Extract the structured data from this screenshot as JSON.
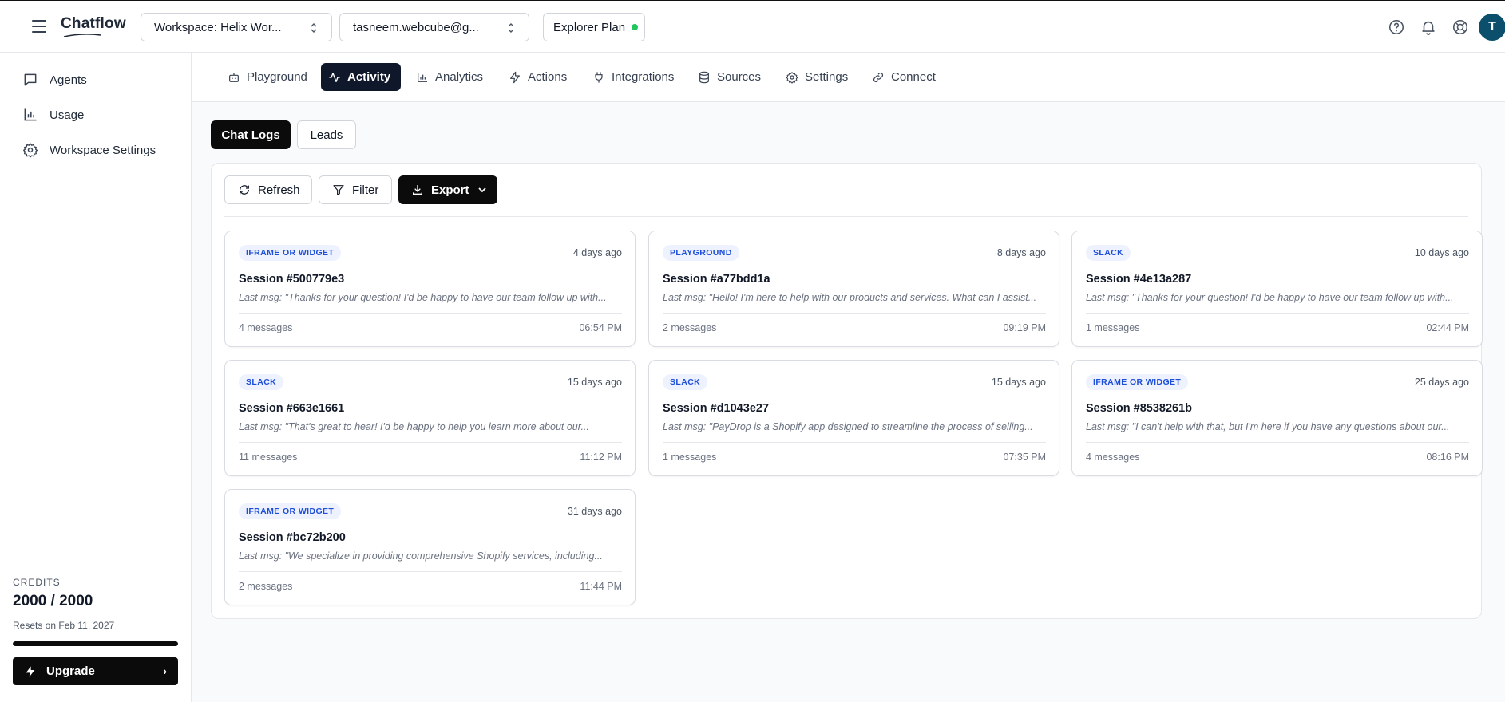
{
  "header": {
    "logo": "Chatflow",
    "workspace_selector": "Workspace: Helix Wor...",
    "account_selector": "tasneem.webcube@g...",
    "plan": "Explorer Plan",
    "avatar_initial": "T",
    "plan_status_color": "#22c55e"
  },
  "sidebar": {
    "items": [
      {
        "label": "Agents",
        "icon": "chat-bubble-icon"
      },
      {
        "label": "Usage",
        "icon": "bar-chart-icon"
      },
      {
        "label": "Workspace Settings",
        "icon": "gear-icon"
      }
    ],
    "credits_label": "CREDITS",
    "credits_value": "2000 / 2000",
    "credits_reset": "Resets on Feb 11, 2027",
    "credits_fraction": 1.0,
    "upgrade_label": "Upgrade",
    "upgrade_arrow": "›"
  },
  "tabs": [
    {
      "label": "Playground",
      "icon": "bot-icon",
      "active": false
    },
    {
      "label": "Activity",
      "icon": "activity-icon",
      "active": true
    },
    {
      "label": "Analytics",
      "icon": "bar-chart-icon",
      "active": false
    },
    {
      "label": "Actions",
      "icon": "bolt-icon",
      "active": false
    },
    {
      "label": "Integrations",
      "icon": "plug-icon",
      "active": false
    },
    {
      "label": "Sources",
      "icon": "database-icon",
      "active": false
    },
    {
      "label": "Settings",
      "icon": "gear-icon",
      "active": false
    },
    {
      "label": "Connect",
      "icon": "link-icon",
      "active": false
    }
  ],
  "subtabs": {
    "chat_logs": "Chat Logs",
    "leads": "Leads"
  },
  "toolbar": {
    "refresh": "Refresh",
    "filter": "Filter",
    "export": "Export"
  },
  "sessions": [
    {
      "source": "IFRAME OR WIDGET",
      "ago": "4 days ago",
      "title": "Session #500779e3",
      "last_msg": "Last msg: \"Thanks for your question! I'd be happy to have our team follow up with...",
      "messages": "4 messages",
      "time": "06:54 PM"
    },
    {
      "source": "PLAYGROUND",
      "ago": "8 days ago",
      "title": "Session #a77bdd1a",
      "last_msg": "Last msg: \"Hello! I'm here to help with our products and services. What can I assist...",
      "messages": "2 messages",
      "time": "09:19 PM"
    },
    {
      "source": "SLACK",
      "ago": "10 days ago",
      "title": "Session #4e13a287",
      "last_msg": "Last msg: \"Thanks for your question! I'd be happy to have our team follow up with...",
      "messages": "1 messages",
      "time": "02:44 PM"
    },
    {
      "source": "SLACK",
      "ago": "15 days ago",
      "title": "Session #663e1661",
      "last_msg": "Last msg: \"That's great to hear! I'd be happy to help you learn more about our...",
      "messages": "11 messages",
      "time": "11:12 PM"
    },
    {
      "source": "SLACK",
      "ago": "15 days ago",
      "title": "Session #d1043e27",
      "last_msg": "Last msg: \"PayDrop is a Shopify app designed to streamline the process of selling...",
      "messages": "1 messages",
      "time": "07:35 PM"
    },
    {
      "source": "IFRAME OR WIDGET",
      "ago": "25 days ago",
      "title": "Session #8538261b",
      "last_msg": "Last msg: \"I can't help with that, but I'm here if you have any questions about our...",
      "messages": "4 messages",
      "time": "08:16 PM"
    },
    {
      "source": "IFRAME OR WIDGET",
      "ago": "31 days ago",
      "title": "Session #bc72b200",
      "last_msg": "Last msg: \"We specialize in providing comprehensive Shopify services, including...",
      "messages": "2 messages",
      "time": "11:44 PM"
    }
  ]
}
